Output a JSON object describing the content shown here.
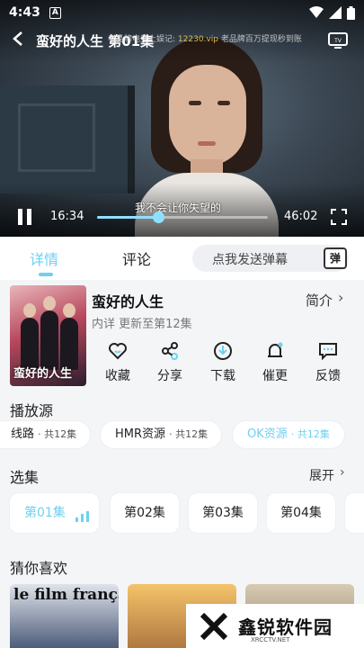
{
  "status_bar": {
    "time": "4:43",
    "notification_badge": "A"
  },
  "player": {
    "title": "蛮好的人生 第01集",
    "marquee_text": "老品牌电竞上娱记:",
    "marquee_highlight": "12230.vip",
    "marquee_suffix": "老品牌百万提现秒到账",
    "subtitle": "我不会让你失望的",
    "current_time": "16:34",
    "duration": "46:02",
    "progress": 0.36
  },
  "tabs": {
    "details": "详情",
    "comments": "评论"
  },
  "danmaku": {
    "placeholder": "点我发送弹幕",
    "button": "弹"
  },
  "show": {
    "poster_title": "蛮好的人生",
    "title": "蛮好的人生",
    "meta": "内详 更新至第12集",
    "intro_label": "简介",
    "actions": [
      {
        "icon": "heart-icon",
        "label": "收藏"
      },
      {
        "icon": "share-icon",
        "label": "分享"
      },
      {
        "icon": "download-icon",
        "label": "下载"
      },
      {
        "icon": "bell-icon",
        "label": "催更"
      },
      {
        "icon": "feedback-icon",
        "label": "反馈"
      }
    ]
  },
  "sources": {
    "title": "播放源",
    "items": [
      {
        "name": "线路",
        "count": "· 共12集"
      },
      {
        "name": "HMR资源",
        "count": "· 共12集"
      },
      {
        "name": "OK资源",
        "count": "· 共12集"
      }
    ]
  },
  "episodes": {
    "title": "选集",
    "expand": "展开",
    "items": [
      "第01集",
      "第02集",
      "第03集",
      "第04集"
    ]
  },
  "recommendations": {
    "title": "猜你喜欢",
    "items": [
      {
        "label": "le film français"
      }
    ]
  },
  "watermark": {
    "brand": "鑫锐软件园",
    "small": "XRCCTV.NET"
  },
  "colors": {
    "accent": "#6fd0f2"
  }
}
